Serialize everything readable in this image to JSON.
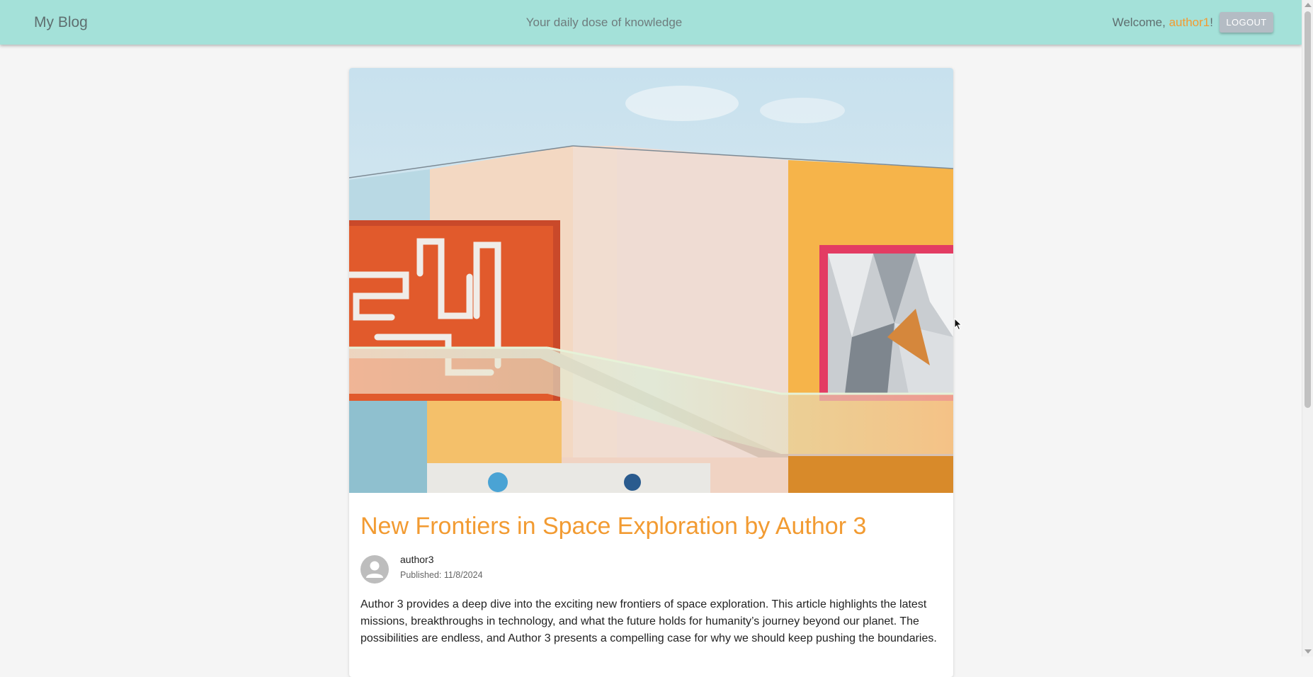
{
  "header": {
    "brand": "My Blog",
    "tagline": "Your daily dose of knowledge",
    "welcome_prefix": "Welcome, ",
    "username": "author1",
    "welcome_suffix": "!",
    "logout_label": "LOGOUT"
  },
  "post": {
    "title": "New Frontiers in Space Exploration by Author 3",
    "author": "author3",
    "published": "Published: 11/8/2024",
    "excerpt": "Author 3 provides a deep dive into the exciting new frontiers of space exploration. This article highlights the latest missions, breakthroughs in technology, and what the future holds for humanity’s journey beyond our planet. The possibilities are endless, and Author 3 presents a compelling case for why we should keep pushing the boundaries."
  },
  "colors": {
    "header_bg": "#a4e1d9",
    "accent": "#f29b32",
    "page_bg": "#f5f5f5"
  },
  "icons": {
    "avatar": "person-icon"
  }
}
